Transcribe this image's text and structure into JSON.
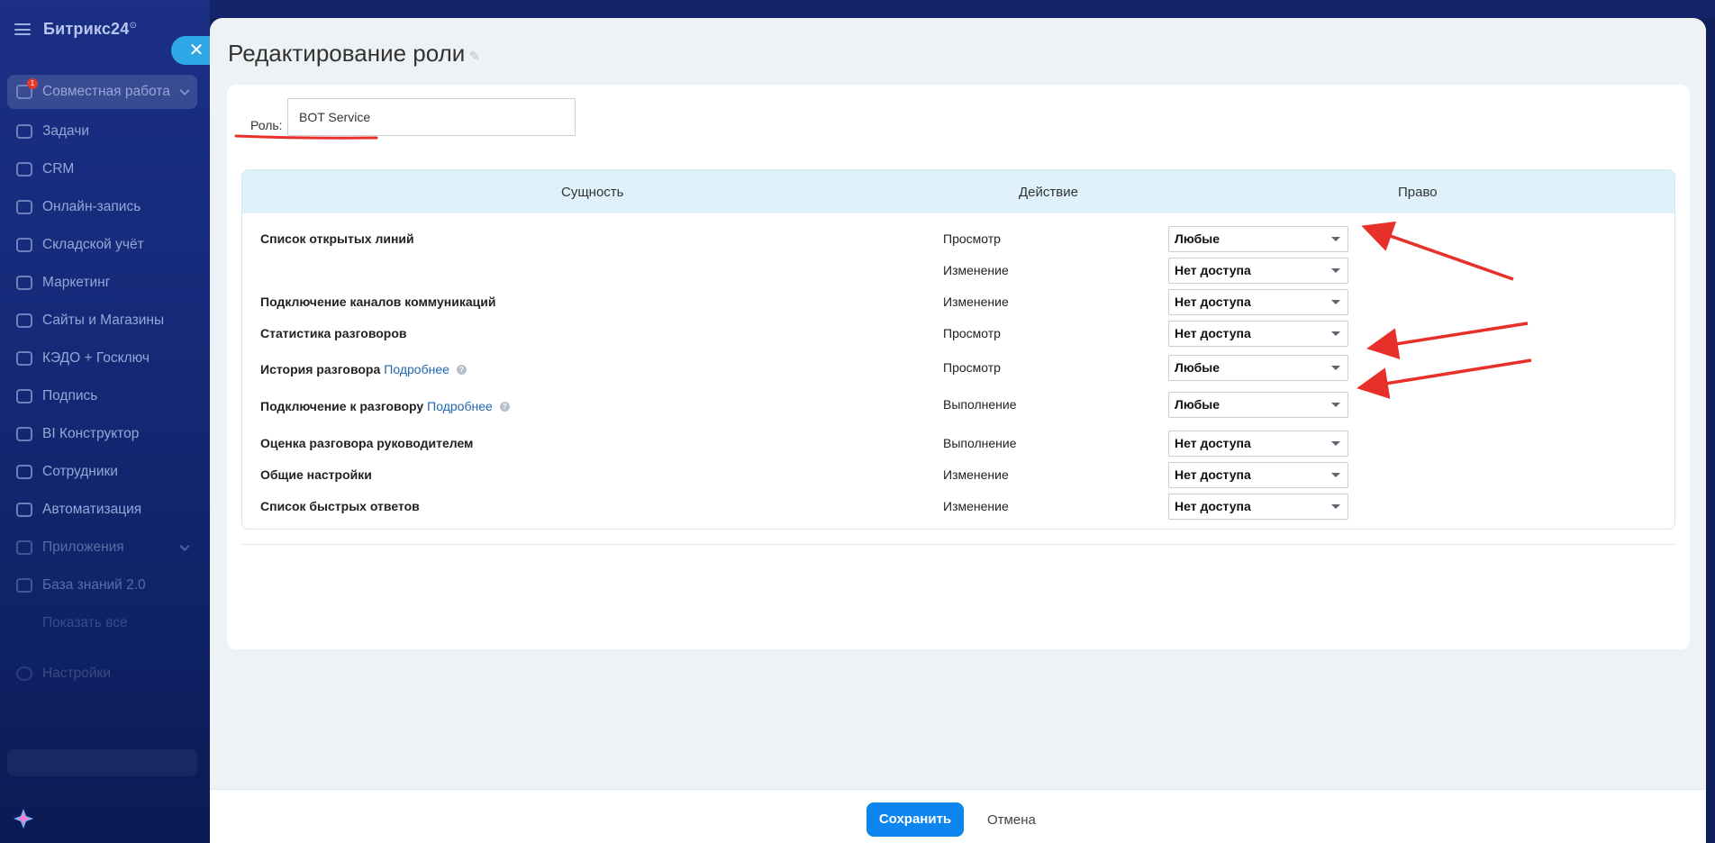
{
  "sidebar": {
    "logo": "Битрикс24",
    "logo_mark": "⊙",
    "close_symbol": "✕",
    "items": [
      {
        "label": "Совместная работа",
        "icon": "collaboration-icon",
        "badge": "1"
      },
      {
        "label": "Задачи",
        "icon": "tasks-icon"
      },
      {
        "label": "CRM",
        "icon": "crm-icon"
      },
      {
        "label": "Онлайн-запись",
        "icon": "booking-icon"
      },
      {
        "label": "Складской учёт",
        "icon": "warehouse-icon"
      },
      {
        "label": "Маркетинг",
        "icon": "marketing-icon"
      },
      {
        "label": "Сайты и Магазины",
        "icon": "shop-icon"
      },
      {
        "label": "КЭДО + Госключ",
        "icon": "edo-icon"
      },
      {
        "label": "Подпись",
        "icon": "signature-icon"
      },
      {
        "label": "BI Конструктор",
        "icon": "bi-icon"
      },
      {
        "label": "Сотрудники",
        "icon": "employees-icon"
      },
      {
        "label": "Автоматизация",
        "icon": "automation-icon"
      },
      {
        "label": "Приложения",
        "icon": "apps-icon"
      },
      {
        "label": "База знаний 2.0",
        "icon": "knowledge-icon"
      },
      {
        "label": "Показать все",
        "icon": "chevron-down-icon"
      },
      {
        "label": "Настройки",
        "icon": "settings-icon"
      }
    ]
  },
  "panel": {
    "title": "Редактирование роли",
    "role_label": "Роль:",
    "role_value": "BOT Service",
    "columns": [
      "Сущность",
      "Действие",
      "Право"
    ],
    "rows": [
      {
        "entity": "Список открытых линий",
        "more": "",
        "action": "Просмотр",
        "right": "Любые"
      },
      {
        "entity": "",
        "more": "",
        "action": "Изменение",
        "right": "Нет доступа"
      },
      {
        "entity": "Подключение каналов коммуникаций",
        "more": "",
        "action": "Изменение",
        "right": "Нет доступа"
      },
      {
        "entity": "Статистика разговоров",
        "more": "",
        "action": "Просмотр",
        "right": "Нет доступа"
      },
      {
        "entity": "История разговора",
        "more": "Подробнее",
        "action": "Просмотр",
        "right": "Любые"
      },
      {
        "entity": "Подключение к разговору",
        "more": "Подробнее",
        "action": "Выполнение",
        "right": "Любые"
      },
      {
        "entity": "Оценка разговора руководителем",
        "more": "",
        "action": "Выполнение",
        "right": "Нет доступа"
      },
      {
        "entity": "Общие настройки",
        "more": "",
        "action": "Изменение",
        "right": "Нет доступа"
      },
      {
        "entity": "Список быстрых ответов",
        "more": "",
        "action": "Изменение",
        "right": "Нет доступа"
      }
    ]
  },
  "footer": {
    "save": "Сохранить",
    "cancel": "Отмена"
  },
  "colors": {
    "accent": "#0c86ee",
    "annotation": "#e8302a",
    "header_bg": "#dff1fa"
  }
}
